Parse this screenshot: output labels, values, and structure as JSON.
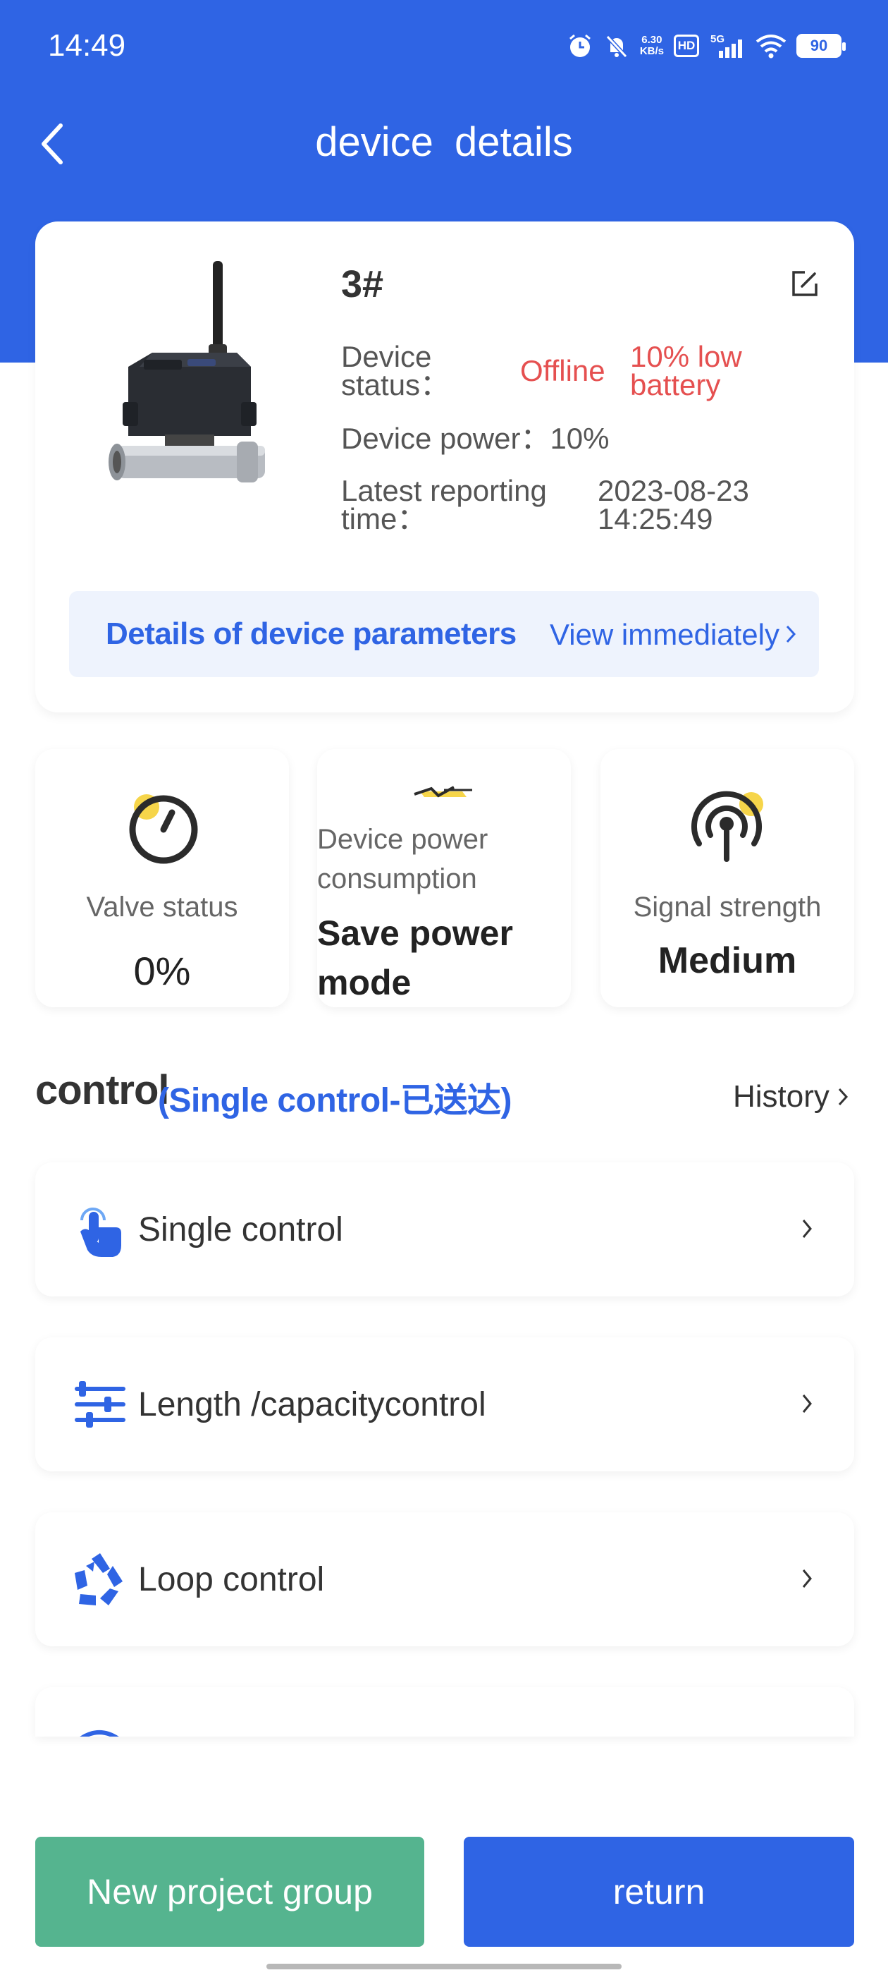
{
  "status_bar": {
    "time": "14:49",
    "net_speed_value": "6.30",
    "net_speed_unit": "KB/s",
    "hd": "HD",
    "network": "5G",
    "battery": "90"
  },
  "header": {
    "title": "device  details",
    "back_icon": "chevron-left-icon"
  },
  "device": {
    "name": "3#",
    "status_label": "Device status：",
    "status_value": "Offline",
    "battery_warning": "10% low battery",
    "power_label": "Device power：",
    "power_value": "10%",
    "report_label": "Latest reporting time：",
    "report_date": "2023-08-23",
    "report_time": "14:25:49",
    "edit_icon": "edit-icon"
  },
  "params": {
    "title": "Details of device parameters",
    "link": "View immediately"
  },
  "stats": {
    "valve": {
      "label": "Valve status",
      "value": "0%",
      "icon": "gauge-icon"
    },
    "power": {
      "label": "Device power consumption",
      "value": "Save power mode",
      "icon": "power-mode-icon"
    },
    "signal": {
      "label": "Signal strength",
      "value": "Medium",
      "icon": "signal-icon"
    }
  },
  "control": {
    "title": "control",
    "subtitle": "(Single control-已送达)",
    "history": "History",
    "items": [
      {
        "label": "Single control",
        "icon": "tap-hand-icon"
      },
      {
        "label": "Length /capacitycontrol",
        "icon": "sliders-icon"
      },
      {
        "label": "Loop control",
        "icon": "recycle-icon"
      }
    ]
  },
  "buttons": {
    "new_group": "New project group",
    "return": "return"
  },
  "colors": {
    "primary": "#2f64e4",
    "green": "#55b48f",
    "alert": "#e55050",
    "accent_yellow": "#f6d54a"
  }
}
